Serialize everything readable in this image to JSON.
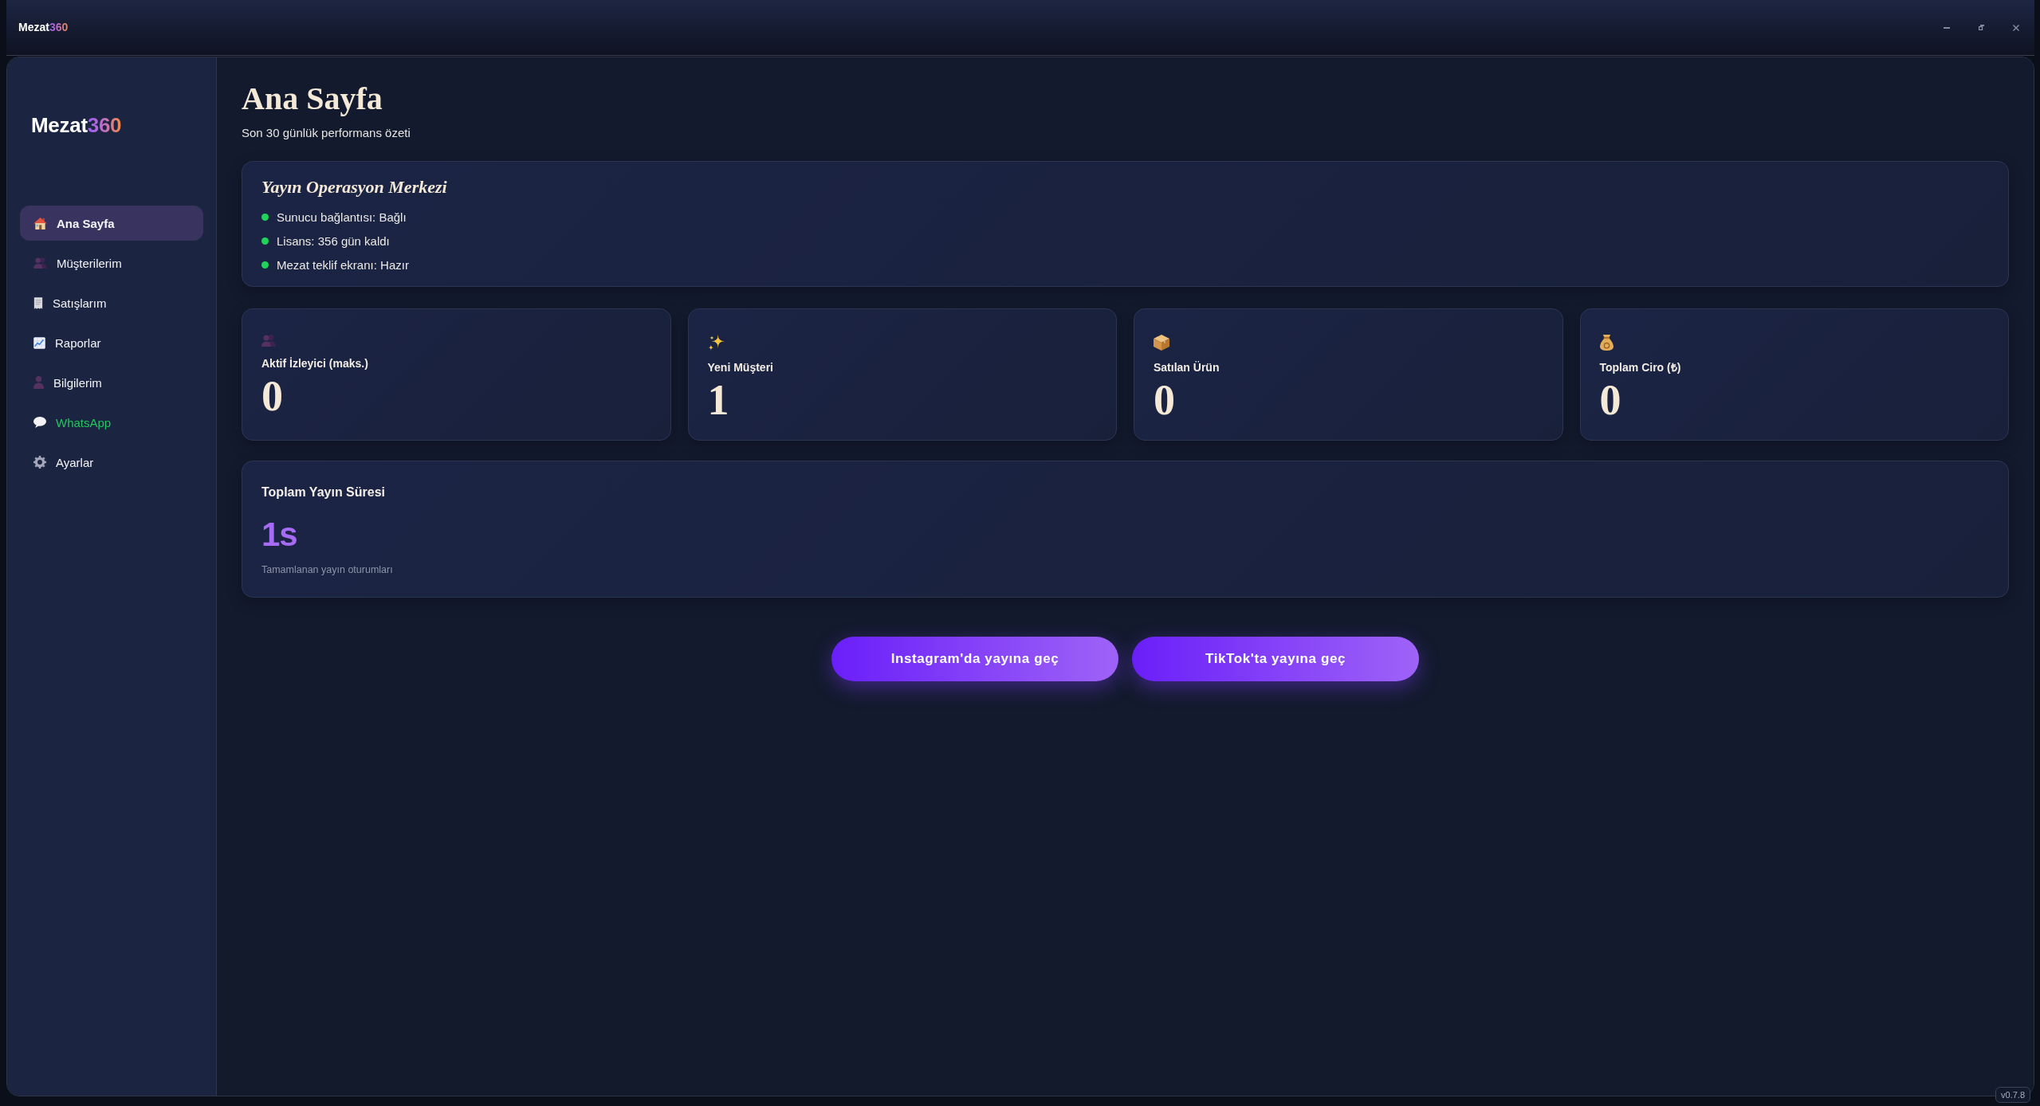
{
  "window": {
    "title": {
      "text": "Mezat",
      "accent": "360"
    }
  },
  "sidebar": {
    "logo": {
      "text": "Mezat",
      "accent": "360"
    },
    "items": [
      {
        "label": "Ana Sayfa",
        "selected": true
      },
      {
        "label": "Müşterilerim",
        "selected": false
      },
      {
        "label": "Satışlarım",
        "selected": false
      },
      {
        "label": "Raporlar",
        "selected": false
      },
      {
        "label": "Bilgilerim",
        "selected": false
      },
      {
        "label": "WhatsApp",
        "selected": false,
        "color": "#22c55e"
      },
      {
        "label": "Ayarlar",
        "selected": false
      }
    ]
  },
  "page": {
    "title": "Ana Sayfa",
    "subtitle": "Son 30 günlük performans özeti"
  },
  "operations_panel": {
    "title": "Yayın Operasyon Merkezi",
    "items": [
      {
        "text": "Sunucu bağlantısı: Bağlı",
        "color": "#22d35a"
      },
      {
        "text": "Lisans: 356 gün kaldı",
        "color": "#22d35a"
      },
      {
        "text": "Mezat teklif ekranı: Hazır",
        "color": "#22d35a"
      }
    ]
  },
  "stats": [
    {
      "label": "Aktif İzleyici (maks.)",
      "value": "0"
    },
    {
      "label": "Yeni Müşteri",
      "value": "1"
    },
    {
      "label": "Satılan Ürün",
      "value": "0"
    },
    {
      "label": "Toplam Ciro (₺)",
      "value": "0"
    }
  ],
  "duration_panel": {
    "title": "Toplam Yayın Süresi",
    "value": "1s",
    "caption": "Tamamlanan yayın oturumları"
  },
  "actions": [
    {
      "label": "Instagram'da yayına geç"
    },
    {
      "label": "TikTok'ta yayına geç"
    }
  ],
  "version": "v0.7.8"
}
